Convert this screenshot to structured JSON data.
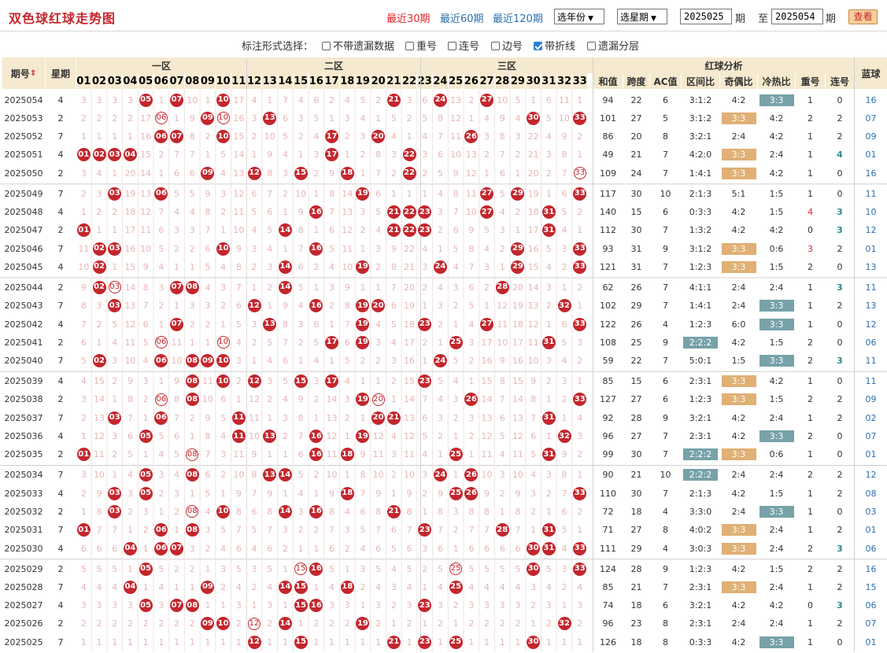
{
  "title": "双色球红球走势图",
  "ranges": [
    "最近30期",
    "最近60期",
    "最近120期"
  ],
  "active_range": 0,
  "year_select": "选年份",
  "period_select": "选星期",
  "from_issue": "2025025",
  "to_issue": "2025054",
  "period_unit": "期",
  "to_text": "至",
  "view_button": "查看",
  "options_label": "标注形式选择：",
  "options": [
    {
      "label": "不带遗漏数据",
      "checked": false
    },
    {
      "label": "重号",
      "checked": false
    },
    {
      "label": "连号",
      "checked": false
    },
    {
      "label": "边号",
      "checked": false
    },
    {
      "label": "带折线",
      "checked": true
    },
    {
      "label": "遗漏分层",
      "checked": false
    }
  ],
  "headers": {
    "issue": "期号",
    "weekday": "星期",
    "zone1": "一区",
    "zone2": "二区",
    "zone3": "三区",
    "analysis": "红球分析",
    "blue": "蓝球",
    "sort_icon": "sort-arrows-icon"
  },
  "analysis_headers": [
    "和值",
    "跨度",
    "AC值",
    "区间比",
    "奇偶比",
    "冷热比",
    "重号",
    "连号"
  ],
  "numbers": [
    "01",
    "02",
    "03",
    "04",
    "05",
    "06",
    "07",
    "08",
    "09",
    "10",
    "11",
    "12",
    "13",
    "14",
    "15",
    "16",
    "17",
    "18",
    "19",
    "20",
    "21",
    "22",
    "23",
    "24",
    "25",
    "26",
    "27",
    "28",
    "29",
    "30",
    "31",
    "32",
    "33"
  ],
  "colors": {
    "red": "#c4262d",
    "miss_red": "#e8b6b6",
    "header_bg": "#f5e9cf",
    "orange_tag": "#e0b074",
    "teal_tag": "#77a2a8",
    "blue": "#2a6fb0"
  },
  "rows": [
    {
      "issue": "2025054",
      "wd": "4",
      "reds": [
        5,
        7,
        10,
        21,
        24,
        27
      ],
      "sum": "94",
      "span": "22",
      "ac": "6",
      "zone": "3:1:2",
      "oe": "4:2",
      "hc": "3:3",
      "rep": "1",
      "con": "0",
      "blue": "16"
    },
    {
      "issue": "2025053",
      "wd": "2",
      "reds": [
        6,
        9,
        10,
        13,
        30,
        33
      ],
      "sum": "101",
      "span": "27",
      "ac": "5",
      "zone": "3:1:2",
      "oe": "3:3",
      "hc": "4:2",
      "rep": "2",
      "con": "2",
      "blue": "07"
    },
    {
      "issue": "2025052",
      "wd": "7",
      "reds": [
        6,
        7,
        10,
        17,
        20,
        26
      ],
      "sum": "86",
      "span": "20",
      "ac": "8",
      "zone": "3:2:1",
      "oe": "2:4",
      "hc": "4:2",
      "rep": "1",
      "con": "2",
      "blue": "09"
    },
    {
      "issue": "2025051",
      "wd": "4",
      "reds": [
        1,
        2,
        3,
        4,
        17,
        22
      ],
      "sum": "49",
      "span": "21",
      "ac": "7",
      "zone": "4:2:0",
      "oe": "3:3",
      "hc": "2:4",
      "rep": "1",
      "con": "4",
      "blue": "01"
    },
    {
      "issue": "2025050",
      "wd": "2",
      "reds": [
        9,
        12,
        15,
        18,
        22,
        33
      ],
      "sum": "109",
      "span": "24",
      "ac": "7",
      "zone": "1:4:1",
      "oe": "3:3",
      "hc": "4:2",
      "rep": "1",
      "con": "0",
      "blue": "16"
    },
    {
      "issue": "2025049",
      "wd": "7",
      "reds": [
        3,
        6,
        19,
        27,
        29,
        33
      ],
      "sum": "117",
      "span": "30",
      "ac": "10",
      "zone": "2:1:3",
      "oe": "5:1",
      "hc": "1:5",
      "rep": "1",
      "con": "0",
      "blue": "11"
    },
    {
      "issue": "2025048",
      "wd": "4",
      "reds": [
        16,
        21,
        22,
        23,
        27,
        31
      ],
      "sum": "140",
      "span": "15",
      "ac": "6",
      "zone": "0:3:3",
      "oe": "4:2",
      "hc": "1:5",
      "rep": "4",
      "con": "3",
      "blue": "10"
    },
    {
      "issue": "2025047",
      "wd": "2",
      "reds": [
        1,
        14,
        21,
        22,
        23,
        31
      ],
      "sum": "112",
      "span": "30",
      "ac": "7",
      "zone": "1:3:2",
      "oe": "4:2",
      "hc": "4:2",
      "rep": "0",
      "con": "3",
      "blue": "12"
    },
    {
      "issue": "2025046",
      "wd": "7",
      "reds": [
        2,
        3,
        10,
        16,
        29,
        33
      ],
      "sum": "93",
      "span": "31",
      "ac": "9",
      "zone": "3:1:2",
      "oe": "3:3",
      "hc": "0:6",
      "rep": "3",
      "con": "2",
      "blue": "01"
    },
    {
      "issue": "2025045",
      "wd": "4",
      "reds": [
        2,
        14,
        19,
        24,
        29,
        33
      ],
      "sum": "121",
      "span": "31",
      "ac": "7",
      "zone": "1:2:3",
      "oe": "3:3",
      "hc": "1:5",
      "rep": "2",
      "con": "0",
      "blue": "13"
    },
    {
      "issue": "2025044",
      "wd": "2",
      "reds": [
        2,
        3,
        7,
        8,
        14,
        28
      ],
      "sum": "62",
      "span": "26",
      "ac": "7",
      "zone": "4:1:1",
      "oe": "2:4",
      "hc": "2:4",
      "rep": "1",
      "con": "3",
      "blue": "11"
    },
    {
      "issue": "2025043",
      "wd": "7",
      "reds": [
        3,
        12,
        16,
        19,
        20,
        32
      ],
      "sum": "102",
      "span": "29",
      "ac": "7",
      "zone": "1:4:1",
      "oe": "2:4",
      "hc": "3:3",
      "rep": "1",
      "con": "2",
      "blue": "13"
    },
    {
      "issue": "2025042",
      "wd": "4",
      "reds": [
        7,
        13,
        19,
        23,
        27,
        33
      ],
      "sum": "122",
      "span": "26",
      "ac": "4",
      "zone": "1:2:3",
      "oe": "6:0",
      "hc": "3:3",
      "rep": "1",
      "con": "0",
      "blue": "12"
    },
    {
      "issue": "2025041",
      "wd": "2",
      "reds": [
        6,
        10,
        17,
        19,
        25,
        31
      ],
      "sum": "108",
      "span": "25",
      "ac": "9",
      "zone": "2:2:2",
      "oe": "4:2",
      "hc": "1:5",
      "rep": "2",
      "con": "0",
      "blue": "06"
    },
    {
      "issue": "2025040",
      "wd": "7",
      "reds": [
        2,
        6,
        8,
        9,
        10,
        24
      ],
      "sum": "59",
      "span": "22",
      "ac": "7",
      "zone": "5:0:1",
      "oe": "1:5",
      "hc": "3:3",
      "rep": "2",
      "con": "3",
      "blue": "11"
    },
    {
      "issue": "2025039",
      "wd": "4",
      "reds": [
        8,
        10,
        12,
        15,
        17,
        23
      ],
      "sum": "85",
      "span": "15",
      "ac": "6",
      "zone": "2:3:1",
      "oe": "3:3",
      "hc": "4:2",
      "rep": "1",
      "con": "0",
      "blue": "11"
    },
    {
      "issue": "2025038",
      "wd": "2",
      "reds": [
        6,
        8,
        19,
        20,
        26,
        33
      ],
      "sum": "127",
      "span": "27",
      "ac": "6",
      "zone": "1:2:3",
      "oe": "3:3",
      "hc": "1:5",
      "rep": "2",
      "con": "2",
      "blue": "09"
    },
    {
      "issue": "2025037",
      "wd": "7",
      "reds": [
        3,
        6,
        11,
        20,
        21,
        31
      ],
      "sum": "92",
      "span": "28",
      "ac": "9",
      "zone": "3:2:1",
      "oe": "4:2",
      "hc": "2:4",
      "rep": "1",
      "con": "2",
      "blue": "02"
    },
    {
      "issue": "2025036",
      "wd": "4",
      "reds": [
        5,
        11,
        13,
        16,
        19,
        32
      ],
      "sum": "96",
      "span": "27",
      "ac": "7",
      "zone": "2:3:1",
      "oe": "4:2",
      "hc": "3:3",
      "rep": "2",
      "con": "0",
      "blue": "07"
    },
    {
      "issue": "2025035",
      "wd": "2",
      "reds": [
        1,
        8,
        16,
        18,
        25,
        31
      ],
      "sum": "99",
      "span": "30",
      "ac": "7",
      "zone": "2:2:2",
      "oe": "3:3",
      "hc": "0:6",
      "rep": "1",
      "con": "0",
      "blue": "01"
    },
    {
      "issue": "2025034",
      "wd": "7",
      "reds": [
        5,
        8,
        13,
        14,
        24,
        26
      ],
      "sum": "90",
      "span": "21",
      "ac": "10",
      "zone": "2:2:2",
      "oe": "2:4",
      "hc": "2:4",
      "rep": "2",
      "con": "2",
      "blue": "12"
    },
    {
      "issue": "2025033",
      "wd": "4",
      "reds": [
        3,
        5,
        18,
        25,
        26,
        33
      ],
      "sum": "110",
      "span": "30",
      "ac": "7",
      "zone": "2:1:3",
      "oe": "4:2",
      "hc": "1:5",
      "rep": "1",
      "con": "2",
      "blue": "08"
    },
    {
      "issue": "2025032",
      "wd": "2",
      "reds": [
        3,
        8,
        10,
        14,
        16,
        21
      ],
      "sum": "72",
      "span": "18",
      "ac": "4",
      "zone": "3:3:0",
      "oe": "2:4",
      "hc": "3:3",
      "rep": "1",
      "con": "0",
      "blue": "03"
    },
    {
      "issue": "2025031",
      "wd": "7",
      "reds": [
        1,
        6,
        8,
        23,
        28,
        31
      ],
      "sum": "71",
      "span": "27",
      "ac": "8",
      "zone": "4:0:2",
      "oe": "3:3",
      "hc": "2:4",
      "rep": "1",
      "con": "2",
      "blue": "01"
    },
    {
      "issue": "2025030",
      "wd": "4",
      "reds": [
        4,
        6,
        7,
        30,
        31,
        33
      ],
      "sum": "111",
      "span": "29",
      "ac": "4",
      "zone": "3:0:3",
      "oe": "3:3",
      "hc": "2:4",
      "rep": "2",
      "con": "3",
      "blue": "06"
    },
    {
      "issue": "2025029",
      "wd": "2",
      "reds": [
        5,
        15,
        16,
        25,
        30,
        33
      ],
      "sum": "124",
      "span": "28",
      "ac": "9",
      "zone": "1:2:3",
      "oe": "4:2",
      "hc": "1:5",
      "rep": "2",
      "con": "2",
      "blue": "16"
    },
    {
      "issue": "2025028",
      "wd": "7",
      "reds": [
        4,
        9,
        14,
        15,
        18,
        25
      ],
      "sum": "85",
      "span": "21",
      "ac": "7",
      "zone": "2:3:1",
      "oe": "3:3",
      "hc": "2:4",
      "rep": "1",
      "con": "2",
      "blue": "15"
    },
    {
      "issue": "2025027",
      "wd": "4",
      "reds": [
        5,
        7,
        8,
        15,
        16,
        23
      ],
      "sum": "74",
      "span": "18",
      "ac": "6",
      "zone": "3:2:1",
      "oe": "4:2",
      "hc": "4:2",
      "rep": "0",
      "con": "3",
      "blue": "06"
    },
    {
      "issue": "2025026",
      "wd": "2",
      "reds": [
        9,
        10,
        12,
        14,
        19,
        32
      ],
      "sum": "96",
      "span": "23",
      "ac": "8",
      "zone": "2:3:1",
      "oe": "2:4",
      "hc": "2:4",
      "rep": "1",
      "con": "2",
      "blue": "07"
    },
    {
      "issue": "2025025",
      "wd": "7",
      "reds": [
        12,
        15,
        21,
        23,
        25,
        30
      ],
      "sum": "126",
      "span": "18",
      "ac": "8",
      "zone": "0:3:3",
      "oe": "4:2",
      "hc": "3:3",
      "rep": "1",
      "con": "0",
      "blue": "01"
    }
  ]
}
